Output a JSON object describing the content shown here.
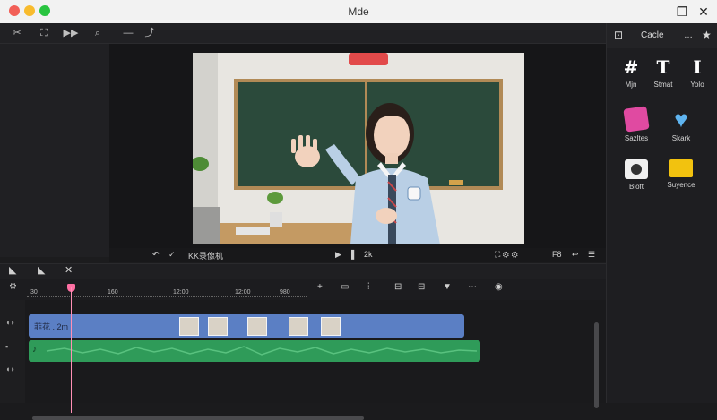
{
  "window": {
    "title": "Mde",
    "controls": {
      "minimize": "—",
      "maximize": "❐",
      "close": "✕"
    }
  },
  "toolbar": {
    "icons": [
      "scissors-icon",
      "fullscreen-icon",
      "skip-icon",
      "search-icon",
      "minus-icon",
      "export-icon"
    ]
  },
  "viewer": {
    "project_name": "KK录像机",
    "play_label": "▶",
    "pause_label": "▌",
    "zoom_label": "2k",
    "right_labels": [
      "⛶ ⚙ ⚙",
      "F8",
      "↩",
      "☰"
    ]
  },
  "timeline": {
    "ruler": {
      "start_label": "30",
      "marks": [
        "160",
        "12:00",
        "12:00",
        "980"
      ]
    },
    "video_clip_label": "菲花 . 2m",
    "audio_clip_label": "♪"
  },
  "right_panel": {
    "tab_label": "Cacle",
    "items": [
      {
        "label": "Mjn",
        "icon": "grid-icon",
        "glyph": "#"
      },
      {
        "label": "Stmat",
        "icon": "text-icon",
        "glyph": "T"
      },
      {
        "label": "Yolo",
        "icon": "cursor-icon",
        "glyph": "I"
      },
      {
        "label": "Sazltes",
        "icon": "sticker-icon",
        "glyph": ""
      },
      {
        "label": "Skark",
        "icon": "heart-icon",
        "glyph": ""
      },
      {
        "label": "Bloft",
        "icon": "camera-icon",
        "glyph": ""
      },
      {
        "label": "Suyence",
        "icon": "speech-bubble-icon",
        "glyph": ""
      }
    ]
  },
  "colors": {
    "video_clip": "#5b7fc4",
    "audio_clip": "#2f9b59",
    "playhead": "#ff6fa3",
    "accent_blue": "#4a90e2"
  }
}
